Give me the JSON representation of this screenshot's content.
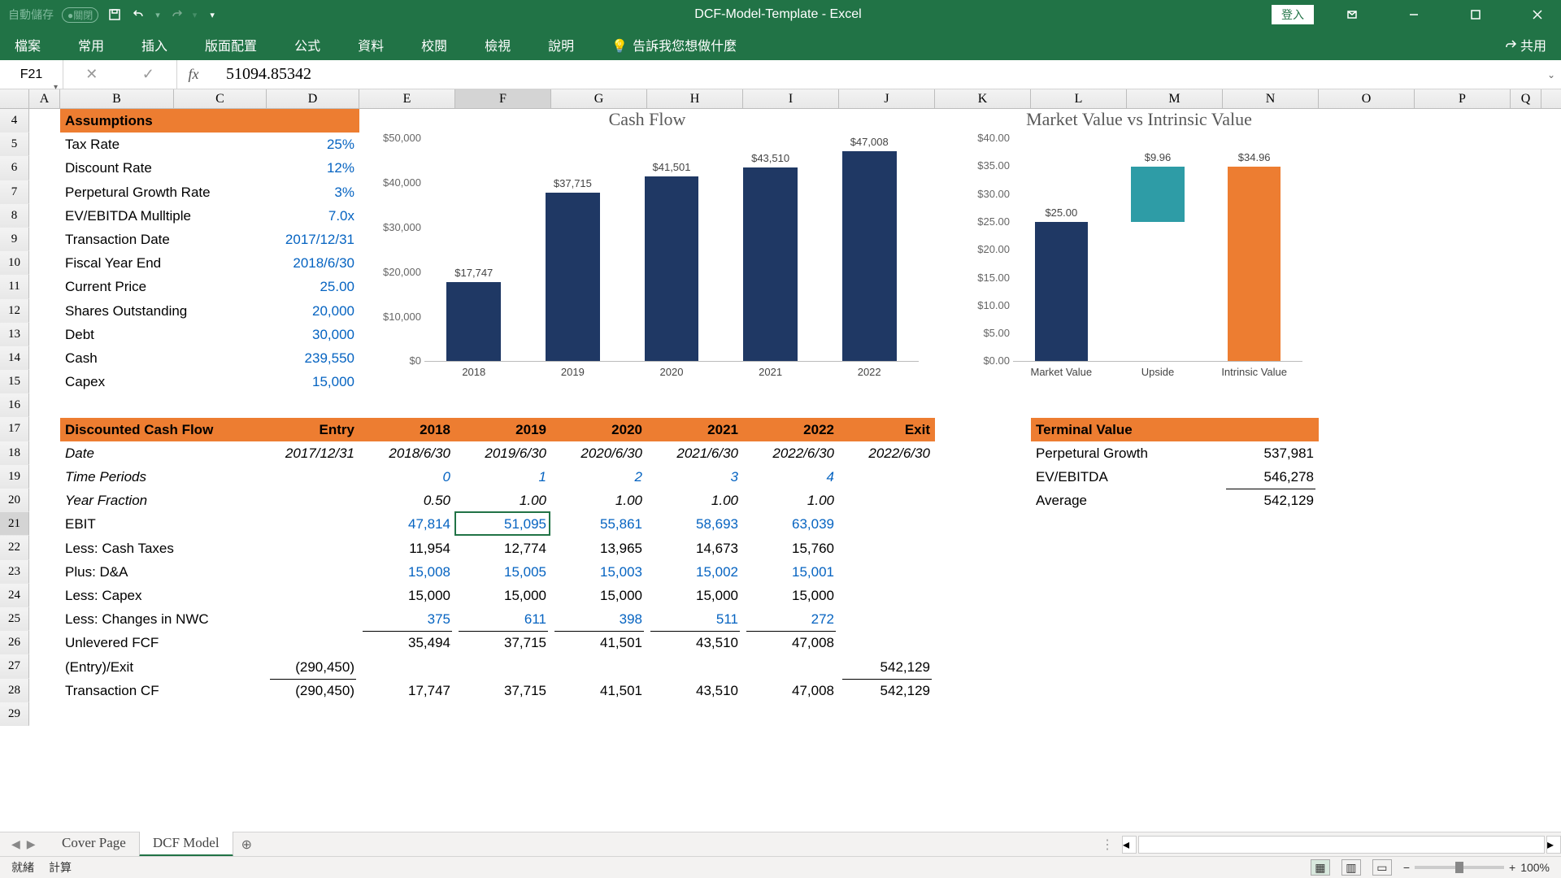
{
  "title_left_autosave": "自動儲存",
  "title_left_pill": "●關閉",
  "app_title": "DCF-Model-Template  -  Excel",
  "login": "登入",
  "ribbon": [
    "檔案",
    "常用",
    "插入",
    "版面配置",
    "公式",
    "資料",
    "校閱",
    "檢視",
    "說明"
  ],
  "tell_me": "告訴我您想做什麼",
  "share": "共用",
  "name_box": "F21",
  "formula": "51094.85342",
  "cols": {
    "A": 38,
    "B": 140,
    "C": 114,
    "D": 114,
    "E": 118,
    "F": 118,
    "G": 118,
    "H": 118,
    "I": 118,
    "J": 118,
    "K": 118,
    "L": 118,
    "M": 118,
    "N": 118,
    "O": 118,
    "P": 118,
    "Q": 38
  },
  "row_start": 4,
  "row_end": 29,
  "assumptions_hdr": "Assumptions",
  "assumptions": [
    {
      "label": "Tax Rate",
      "val": "25%"
    },
    {
      "label": "Discount Rate",
      "val": "12%"
    },
    {
      "label": "Perpetural Growth Rate",
      "val": "3%"
    },
    {
      "label": "EV/EBITDA Mulltiple",
      "val": "7.0x"
    },
    {
      "label": "Transaction Date",
      "val": "2017/12/31"
    },
    {
      "label": "Fiscal Year End",
      "val": "2018/6/30"
    },
    {
      "label": "Current Price",
      "val": "25.00"
    },
    {
      "label": "Shares Outstanding",
      "val": "20,000"
    },
    {
      "label": "Debt",
      "val": "30,000"
    },
    {
      "label": "Cash",
      "val": "239,550"
    },
    {
      "label": "Capex",
      "val": "15,000"
    }
  ],
  "dcf_hdr": "Discounted Cash Flow",
  "dcf_cols": [
    "Entry",
    "2018",
    "2019",
    "2020",
    "2021",
    "2022",
    "Exit"
  ],
  "dcf_rows": [
    {
      "label": "Date",
      "italic": true,
      "vals": [
        "2017/12/31",
        "2018/6/30",
        "2019/6/30",
        "2020/6/30",
        "2021/6/30",
        "2022/6/30",
        "2022/6/30"
      ]
    },
    {
      "label": "Time Periods",
      "italic": true,
      "vals": [
        "",
        "0",
        "1",
        "2",
        "3",
        "4",
        ""
      ],
      "blue": true
    },
    {
      "label": "Year Fraction",
      "italic": true,
      "vals": [
        "",
        "0.50",
        "1.00",
        "1.00",
        "1.00",
        "1.00",
        ""
      ]
    },
    {
      "label": "EBIT",
      "vals": [
        "",
        "47,814",
        "51,095",
        "55,861",
        "58,693",
        "63,039",
        ""
      ],
      "blue": true
    },
    {
      "label": "Less: Cash Taxes",
      "vals": [
        "",
        "11,954",
        "12,774",
        "13,965",
        "14,673",
        "15,760",
        ""
      ]
    },
    {
      "label": "Plus: D&A",
      "vals": [
        "",
        "15,008",
        "15,005",
        "15,003",
        "15,002",
        "15,001",
        ""
      ],
      "blue": true
    },
    {
      "label": "Less: Capex",
      "vals": [
        "",
        "15,000",
        "15,000",
        "15,000",
        "15,000",
        "15,000",
        ""
      ]
    },
    {
      "label": "Less: Changes in NWC",
      "vals": [
        "",
        "375",
        "611",
        "398",
        "511",
        "272",
        ""
      ],
      "blue": true
    },
    {
      "label": "Unlevered FCF",
      "vals": [
        "",
        "35,494",
        "37,715",
        "41,501",
        "43,510",
        "47,008",
        ""
      ]
    },
    {
      "label": "(Entry)/Exit",
      "vals": [
        "(290,450)",
        "",
        "",
        "",
        "",
        "",
        "542,129"
      ]
    },
    {
      "label": "Transaction CF",
      "vals": [
        "(290,450)",
        "17,747",
        "37,715",
        "41,501",
        "43,510",
        "47,008",
        "542,129"
      ]
    }
  ],
  "terminal_hdr": "Terminal Value",
  "terminal": [
    {
      "label": "Perpetural Growth",
      "val": "537,981"
    },
    {
      "label": "EV/EBITDA",
      "val": "546,278"
    },
    {
      "label": "Average",
      "val": "542,129"
    }
  ],
  "chart_data": [
    {
      "type": "bar",
      "title": "Cash Flow",
      "categories": [
        "2018",
        "2019",
        "2020",
        "2021",
        "2022"
      ],
      "values": [
        17747,
        37715,
        41501,
        43510,
        47008
      ],
      "labels": [
        "$17,747",
        "$37,715",
        "$41,501",
        "$43,510",
        "$47,008"
      ],
      "yticks": [
        "$0",
        "$10,000",
        "$20,000",
        "$30,000",
        "$40,000",
        "$50,000"
      ],
      "ylim": [
        0,
        50000
      ],
      "colors": [
        "#1F3864"
      ]
    },
    {
      "type": "bar",
      "title": "Market Value vs Intrinsic Value",
      "categories": [
        "Market Value",
        "Upside",
        "Intrinsic Value"
      ],
      "values": [
        25.0,
        9.96,
        34.96
      ],
      "labels": [
        "$25.00",
        "$9.96",
        "$34.96"
      ],
      "yticks": [
        "$0.00",
        "$5.00",
        "$10.00",
        "$15.00",
        "$20.00",
        "$25.00",
        "$30.00",
        "$35.00",
        "$40.00"
      ],
      "ylim": [
        0,
        40
      ],
      "colors": [
        "#1F3864",
        "#2E9CA6",
        "#ED7D31"
      ],
      "float_base": [
        0,
        25.0,
        0
      ]
    }
  ],
  "sheet_tabs": [
    "Cover Page",
    "DCF Model"
  ],
  "active_tab": 1,
  "status_left": [
    "就緒",
    "計算"
  ],
  "zoom": "100%"
}
